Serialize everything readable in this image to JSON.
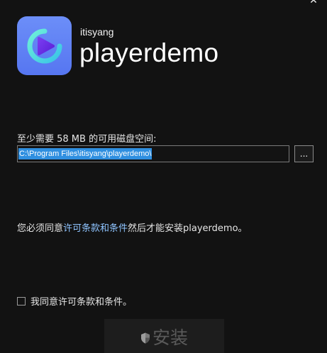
{
  "window": {
    "close_glyph": "✕"
  },
  "header": {
    "vendor": "itisyang",
    "product": "playerdemo",
    "logo_icon": "play-logo-icon",
    "logo_color": "#5f7ff4"
  },
  "install_path": {
    "space_label": "至少需要 58 MB 的可用磁盘空间:",
    "value": "C:\\Program Files\\itisyang\\playerdemo\\",
    "browse_label": "..."
  },
  "license": {
    "prefix": "您必须同意",
    "link_text": "许可条款和条件",
    "suffix": "然后才能安装playerdemo。",
    "link_color": "#8fc4ff"
  },
  "agree": {
    "label": "我同意许可条款和条件。",
    "checked": false
  },
  "install_button": {
    "label": "安装",
    "icon": "shield-icon",
    "enabled": false
  }
}
